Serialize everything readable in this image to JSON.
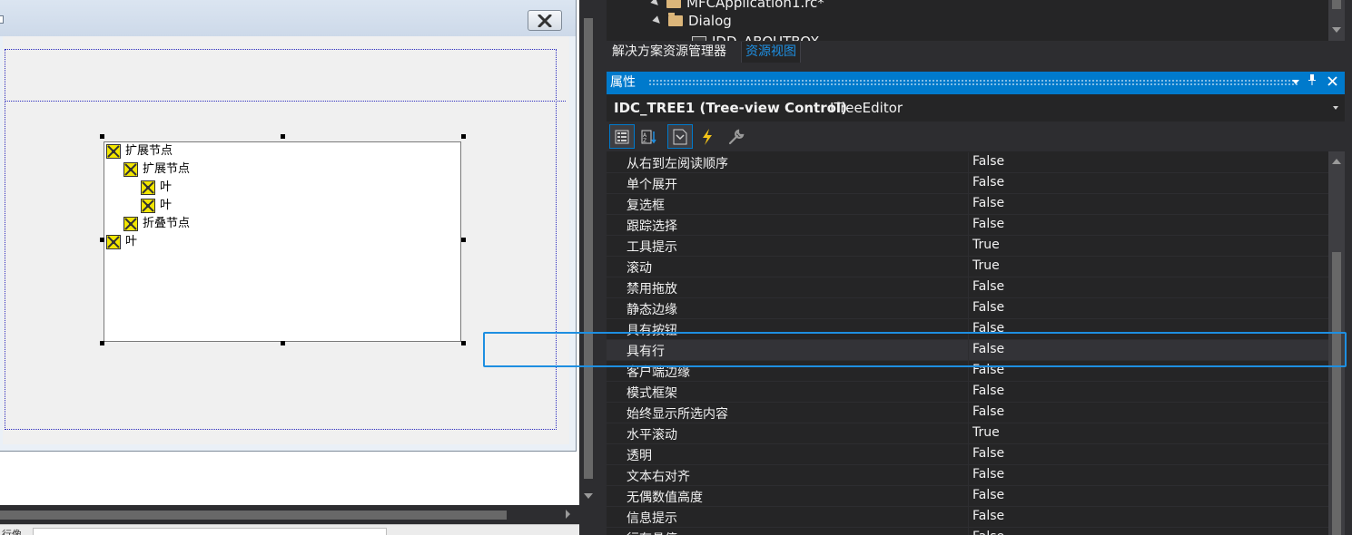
{
  "designer": {
    "tree_nodes": [
      {
        "label": "扩展节点",
        "level": 0
      },
      {
        "label": "扩展节点",
        "level": 1
      },
      {
        "label": "叶",
        "level": 2
      },
      {
        "label": "叶",
        "level": 2
      },
      {
        "label": "折叠节点",
        "level": 1
      },
      {
        "label": "叶",
        "level": 0
      }
    ],
    "bottom_fragment": "行像"
  },
  "resource_tree": {
    "items": [
      {
        "label": "MFCApplication1.rc*"
      },
      {
        "label": "Dialog"
      },
      {
        "label": "IDD_ABOUTBOX"
      }
    ]
  },
  "tabs": [
    {
      "label": "解决方案资源管理器",
      "active": false
    },
    {
      "label": "资源视图",
      "active": true
    }
  ],
  "properties": {
    "title": "属性",
    "object_name": "IDC_TREE1 (Tree-view Control)",
    "object_type": "ITreeEditor",
    "toolbar_icons": [
      "categorized-icon",
      "alphabetical-icon",
      "properties-icon",
      "events-icon",
      "property-pages-icon"
    ],
    "rows": [
      {
        "name": "从右到左阅读顺序",
        "value": "False"
      },
      {
        "name": "单个展开",
        "value": "False"
      },
      {
        "name": "复选框",
        "value": "False"
      },
      {
        "name": "跟踪选择",
        "value": "False"
      },
      {
        "name": "工具提示",
        "value": "True"
      },
      {
        "name": "滚动",
        "value": "True"
      },
      {
        "name": "禁用拖放",
        "value": "False"
      },
      {
        "name": "静态边缘",
        "value": "False"
      },
      {
        "name": "具有按钮",
        "value": "False"
      },
      {
        "name": "具有行",
        "value": "False"
      },
      {
        "name": "客户端边缘",
        "value": "False"
      },
      {
        "name": "模式框架",
        "value": "False"
      },
      {
        "name": "始终显示所选内容",
        "value": "False"
      },
      {
        "name": "水平滚动",
        "value": "True"
      },
      {
        "name": "透明",
        "value": "False"
      },
      {
        "name": "文本右对齐",
        "value": "False"
      },
      {
        "name": "无偶数值高度",
        "value": "False"
      },
      {
        "name": "信息提示",
        "value": "False"
      },
      {
        "name": "行有悬停",
        "value": "False"
      }
    ],
    "selected_row": 9
  },
  "colors": {
    "accent": "#007acc",
    "highlight": "#1e8fe1",
    "panel_bg": "#252526",
    "chrome_bg": "#2d2d30"
  }
}
